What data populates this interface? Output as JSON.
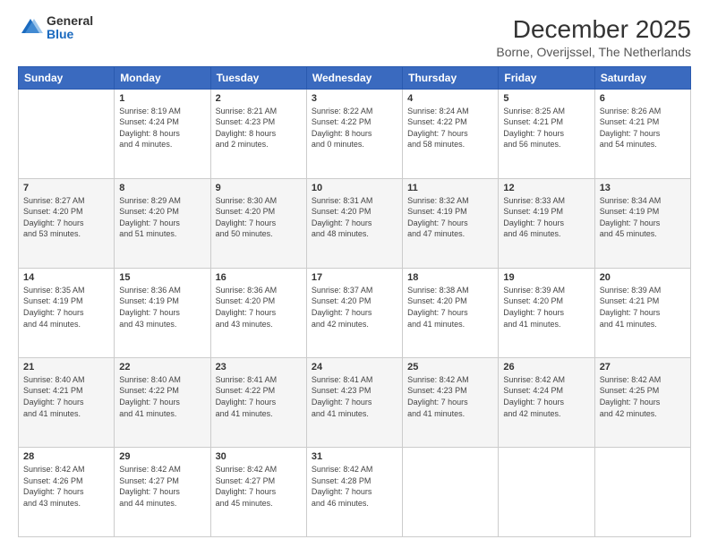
{
  "logo": {
    "general": "General",
    "blue": "Blue"
  },
  "title": "December 2025",
  "subtitle": "Borne, Overijssel, The Netherlands",
  "headers": [
    "Sunday",
    "Monday",
    "Tuesday",
    "Wednesday",
    "Thursday",
    "Friday",
    "Saturday"
  ],
  "weeks": [
    [
      {
        "day": "",
        "info": ""
      },
      {
        "day": "1",
        "info": "Sunrise: 8:19 AM\nSunset: 4:24 PM\nDaylight: 8 hours\nand 4 minutes."
      },
      {
        "day": "2",
        "info": "Sunrise: 8:21 AM\nSunset: 4:23 PM\nDaylight: 8 hours\nand 2 minutes."
      },
      {
        "day": "3",
        "info": "Sunrise: 8:22 AM\nSunset: 4:22 PM\nDaylight: 8 hours\nand 0 minutes."
      },
      {
        "day": "4",
        "info": "Sunrise: 8:24 AM\nSunset: 4:22 PM\nDaylight: 7 hours\nand 58 minutes."
      },
      {
        "day": "5",
        "info": "Sunrise: 8:25 AM\nSunset: 4:21 PM\nDaylight: 7 hours\nand 56 minutes."
      },
      {
        "day": "6",
        "info": "Sunrise: 8:26 AM\nSunset: 4:21 PM\nDaylight: 7 hours\nand 54 minutes."
      }
    ],
    [
      {
        "day": "7",
        "info": "Sunrise: 8:27 AM\nSunset: 4:20 PM\nDaylight: 7 hours\nand 53 minutes."
      },
      {
        "day": "8",
        "info": "Sunrise: 8:29 AM\nSunset: 4:20 PM\nDaylight: 7 hours\nand 51 minutes."
      },
      {
        "day": "9",
        "info": "Sunrise: 8:30 AM\nSunset: 4:20 PM\nDaylight: 7 hours\nand 50 minutes."
      },
      {
        "day": "10",
        "info": "Sunrise: 8:31 AM\nSunset: 4:20 PM\nDaylight: 7 hours\nand 48 minutes."
      },
      {
        "day": "11",
        "info": "Sunrise: 8:32 AM\nSunset: 4:19 PM\nDaylight: 7 hours\nand 47 minutes."
      },
      {
        "day": "12",
        "info": "Sunrise: 8:33 AM\nSunset: 4:19 PM\nDaylight: 7 hours\nand 46 minutes."
      },
      {
        "day": "13",
        "info": "Sunrise: 8:34 AM\nSunset: 4:19 PM\nDaylight: 7 hours\nand 45 minutes."
      }
    ],
    [
      {
        "day": "14",
        "info": "Sunrise: 8:35 AM\nSunset: 4:19 PM\nDaylight: 7 hours\nand 44 minutes."
      },
      {
        "day": "15",
        "info": "Sunrise: 8:36 AM\nSunset: 4:19 PM\nDaylight: 7 hours\nand 43 minutes."
      },
      {
        "day": "16",
        "info": "Sunrise: 8:36 AM\nSunset: 4:20 PM\nDaylight: 7 hours\nand 43 minutes."
      },
      {
        "day": "17",
        "info": "Sunrise: 8:37 AM\nSunset: 4:20 PM\nDaylight: 7 hours\nand 42 minutes."
      },
      {
        "day": "18",
        "info": "Sunrise: 8:38 AM\nSunset: 4:20 PM\nDaylight: 7 hours\nand 41 minutes."
      },
      {
        "day": "19",
        "info": "Sunrise: 8:39 AM\nSunset: 4:20 PM\nDaylight: 7 hours\nand 41 minutes."
      },
      {
        "day": "20",
        "info": "Sunrise: 8:39 AM\nSunset: 4:21 PM\nDaylight: 7 hours\nand 41 minutes."
      }
    ],
    [
      {
        "day": "21",
        "info": "Sunrise: 8:40 AM\nSunset: 4:21 PM\nDaylight: 7 hours\nand 41 minutes."
      },
      {
        "day": "22",
        "info": "Sunrise: 8:40 AM\nSunset: 4:22 PM\nDaylight: 7 hours\nand 41 minutes."
      },
      {
        "day": "23",
        "info": "Sunrise: 8:41 AM\nSunset: 4:22 PM\nDaylight: 7 hours\nand 41 minutes."
      },
      {
        "day": "24",
        "info": "Sunrise: 8:41 AM\nSunset: 4:23 PM\nDaylight: 7 hours\nand 41 minutes."
      },
      {
        "day": "25",
        "info": "Sunrise: 8:42 AM\nSunset: 4:23 PM\nDaylight: 7 hours\nand 41 minutes."
      },
      {
        "day": "26",
        "info": "Sunrise: 8:42 AM\nSunset: 4:24 PM\nDaylight: 7 hours\nand 42 minutes."
      },
      {
        "day": "27",
        "info": "Sunrise: 8:42 AM\nSunset: 4:25 PM\nDaylight: 7 hours\nand 42 minutes."
      }
    ],
    [
      {
        "day": "28",
        "info": "Sunrise: 8:42 AM\nSunset: 4:26 PM\nDaylight: 7 hours\nand 43 minutes."
      },
      {
        "day": "29",
        "info": "Sunrise: 8:42 AM\nSunset: 4:27 PM\nDaylight: 7 hours\nand 44 minutes."
      },
      {
        "day": "30",
        "info": "Sunrise: 8:42 AM\nSunset: 4:27 PM\nDaylight: 7 hours\nand 45 minutes."
      },
      {
        "day": "31",
        "info": "Sunrise: 8:42 AM\nSunset: 4:28 PM\nDaylight: 7 hours\nand 46 minutes."
      },
      {
        "day": "",
        "info": ""
      },
      {
        "day": "",
        "info": ""
      },
      {
        "day": "",
        "info": ""
      }
    ]
  ]
}
